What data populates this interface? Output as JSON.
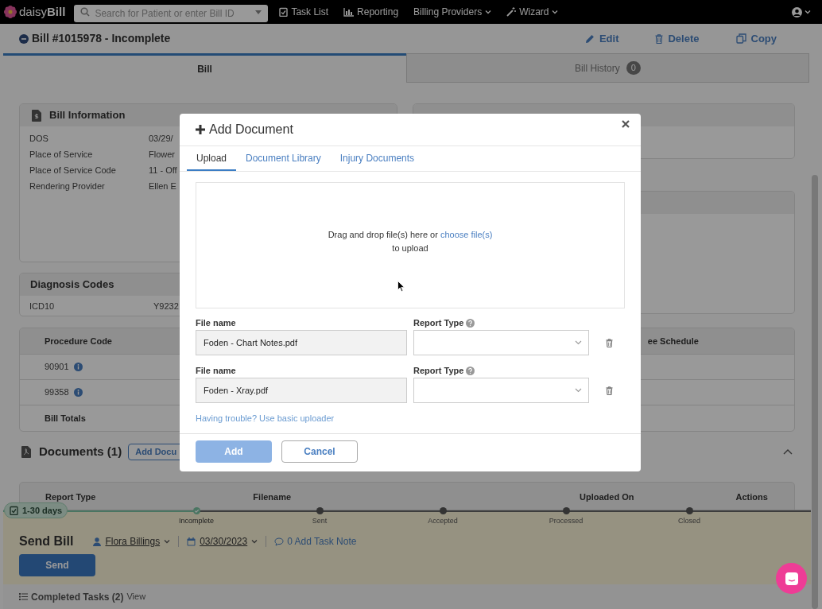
{
  "nav": {
    "logo": "daisy**Bill**",
    "search": {
      "placeholder": "Search for Patient or enter Bill ID"
    },
    "items": [
      {
        "label": "Task List",
        "dropdown": false
      },
      {
        "label": "Reporting",
        "dropdown": false
      },
      {
        "label": "Billing Providers",
        "dropdown": true
      },
      {
        "label": "Wizard",
        "dropdown": true
      }
    ]
  },
  "bill_header": {
    "title": "Bill #1015978 - Incomplete",
    "actions": [
      "Edit",
      "Delete",
      "Copy"
    ]
  },
  "tabs": [
    {
      "label": "Bill",
      "selected": true
    },
    {
      "label": "Bill History",
      "badge": "0",
      "selected": false
    }
  ],
  "bill_information": {
    "title": "Bill Information",
    "rows": [
      {
        "label": "DOS",
        "value": "03/29/"
      },
      {
        "label": "Place of Service",
        "value": "Flower"
      },
      {
        "label": "Place of Service Code",
        "value": "11 - Off"
      },
      {
        "label": "Rendering Provider",
        "value": "Ellen E"
      }
    ]
  },
  "diagnosis_codes": {
    "title": "Diagnosis Codes",
    "rows": [
      {
        "label": "ICD10",
        "value": "Y9232"
      }
    ]
  },
  "procedures": {
    "columns": [
      "Procedure Code",
      "ee Schedule"
    ],
    "rows": [
      {
        "code": "90901",
        "kind": "code"
      },
      {
        "code": "99358",
        "kind": "code"
      },
      {
        "code": "Bill Totals",
        "kind": "total"
      }
    ]
  },
  "documents": {
    "title": "Documents (1)",
    "add_button": "Add Docu",
    "expanded": true,
    "columns": [
      "Report Type",
      "Filename",
      "Uploaded On",
      "Actions"
    ]
  },
  "task": {
    "age_badge": "1-30 days",
    "steps": [
      {
        "label": "Incomplete",
        "done": true
      },
      {
        "label": "Sent",
        "done": false
      },
      {
        "label": "Accepted",
        "done": false
      },
      {
        "label": "Processed",
        "done": false
      },
      {
        "label": "Closed",
        "done": false
      }
    ],
    "title": "Send Bill",
    "assignee": "Flora Billings",
    "date": "03/30/2023",
    "note_link": "0 Add Task Note",
    "send_button": "Send"
  },
  "completed_tasks": {
    "label": "Completed Tasks (2)",
    "link": "View"
  },
  "modal": {
    "title": "Add Document",
    "tabs": [
      {
        "label": "Upload",
        "selected": true
      },
      {
        "label": "Document Library",
        "selected": false
      },
      {
        "label": "Injury Documents",
        "selected": false
      }
    ],
    "dropzone": {
      "text": "Drag and drop file(s) here or",
      "link": "choose file(s)",
      "text2": "to upload"
    },
    "files": [
      {
        "file_label": "File name",
        "file_name": "Foden - Chart Notes.pdf",
        "type_label": "Report Type"
      },
      {
        "file_label": "File name",
        "file_name": "Foden - Xray.pdf",
        "type_label": "Report Type"
      }
    ],
    "help_link": "Having trouble? Use basic uploader",
    "buttons": [
      {
        "label": "Add",
        "disabled": true
      },
      {
        "label": "Cancel",
        "disabled": false
      }
    ]
  }
}
